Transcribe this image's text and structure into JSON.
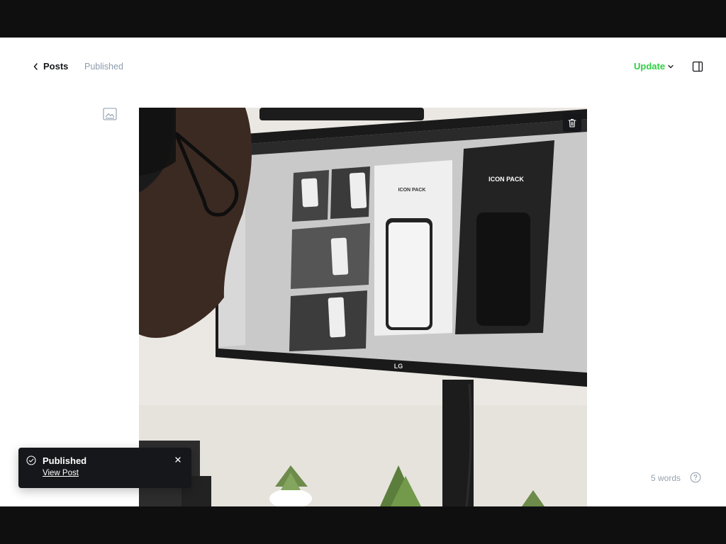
{
  "header": {
    "back_label": "Posts",
    "status": "Published",
    "update_label": "Update"
  },
  "editor": {
    "word_count": "5 words"
  },
  "toast": {
    "title": "Published",
    "link_label": "View Post"
  },
  "image": {
    "monitor_brand": "LG",
    "screen_text": "ICON PACK"
  },
  "icons": {
    "back": "chevron-left-icon",
    "update_dropdown": "chevron-down-icon",
    "sidebar": "sidebar-panel-icon",
    "card": "image-card-icon",
    "delete": "trash-icon",
    "help": "question-circle-icon",
    "toast_status": "check-circle-icon",
    "toast_close": "close-icon"
  },
  "colors": {
    "accent_green": "#30cf43",
    "status_gray": "#8e9cac",
    "dark": "#15171a"
  }
}
